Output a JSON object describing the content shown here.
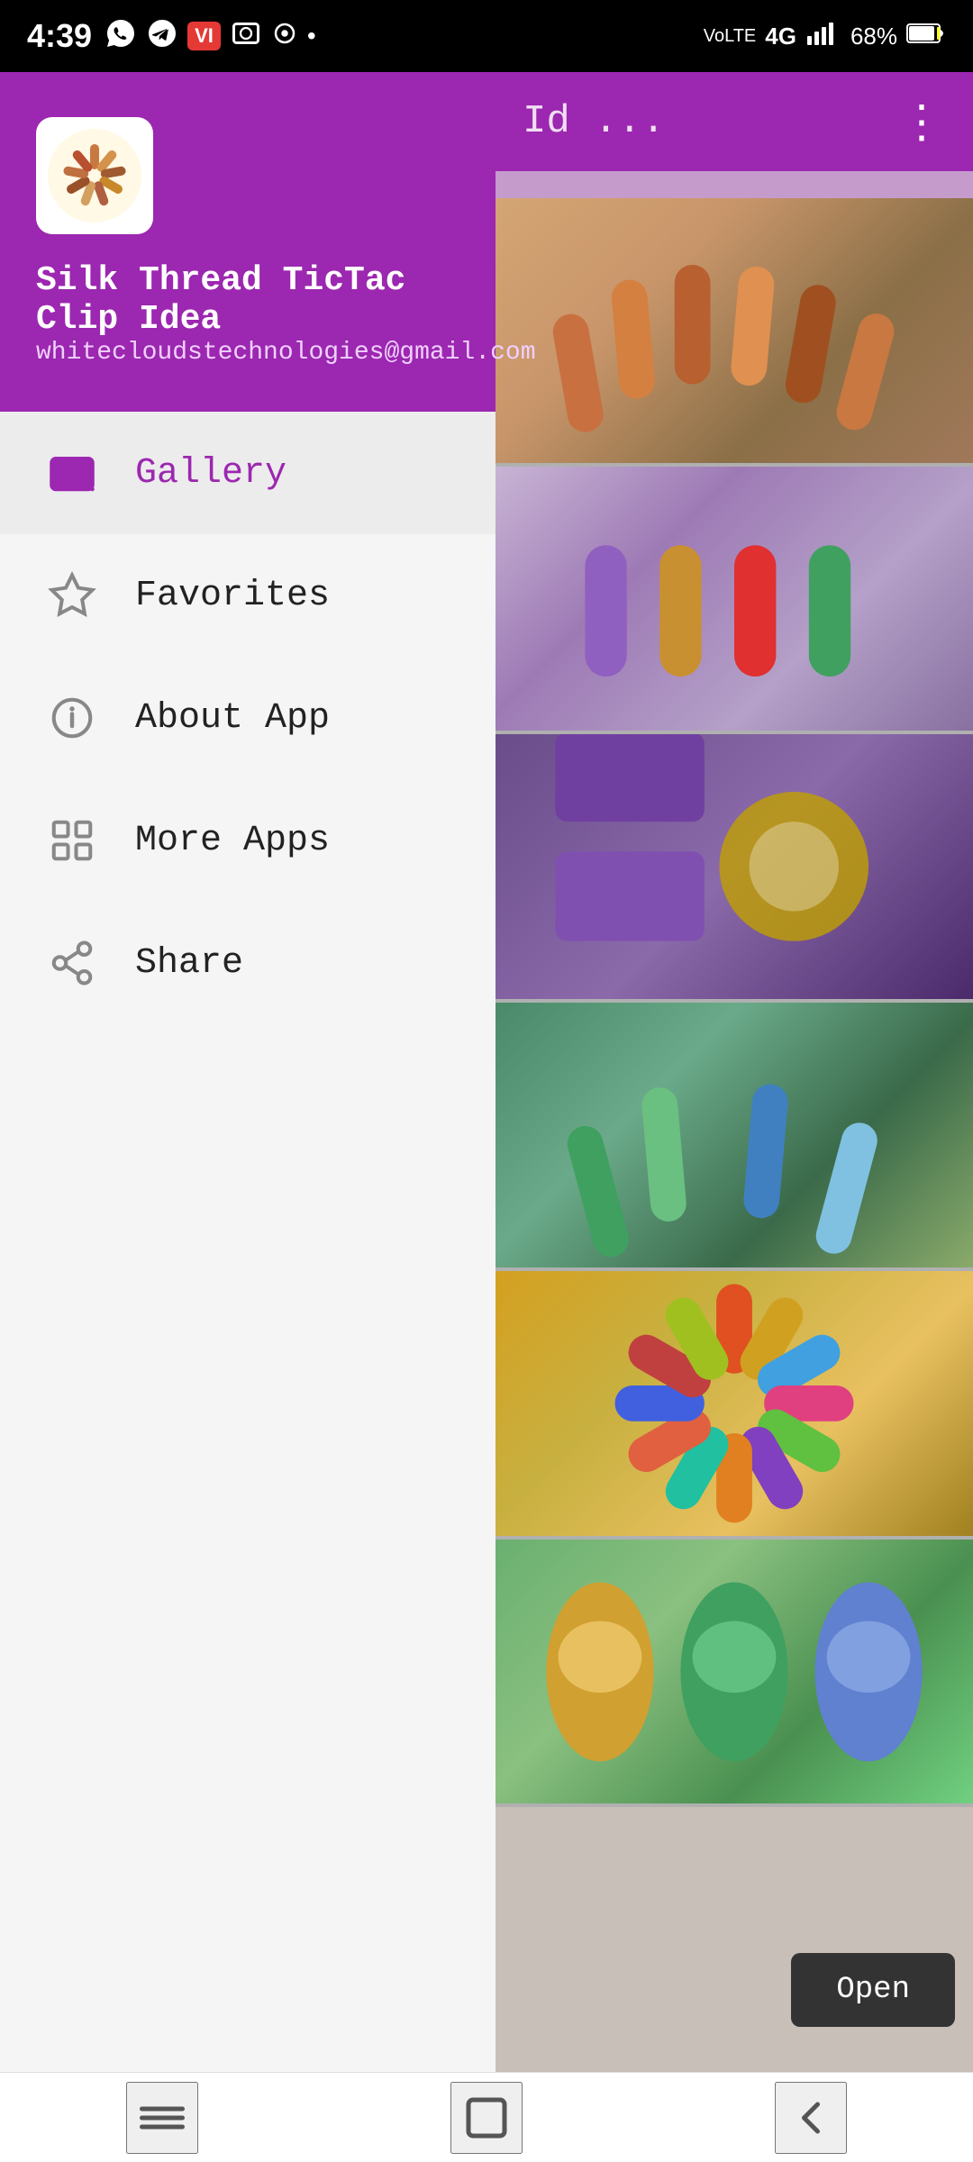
{
  "statusBar": {
    "time": "4:39",
    "battery": "68%",
    "network": "4G",
    "icons": [
      "whatsapp",
      "telegram",
      "vi",
      "browser",
      "notification",
      "dot"
    ]
  },
  "rightPanel": {
    "title": "Id ...",
    "menuDots": "⋮"
  },
  "drawer": {
    "header": {
      "appName": "Silk Thread TicTac Clip Idea",
      "email": "whitecloudstechnologies@gmail.com"
    },
    "menuItems": [
      {
        "id": "gallery",
        "label": "Gallery",
        "active": true
      },
      {
        "id": "favorites",
        "label": "Favorites",
        "active": false
      },
      {
        "id": "about",
        "label": "About App",
        "active": false
      },
      {
        "id": "more-apps",
        "label": "More Apps",
        "active": false
      },
      {
        "id": "share",
        "label": "Share",
        "active": false
      }
    ]
  },
  "openButton": {
    "label": "Open"
  },
  "bottomNav": {
    "buttons": [
      "menu",
      "square",
      "back"
    ]
  }
}
